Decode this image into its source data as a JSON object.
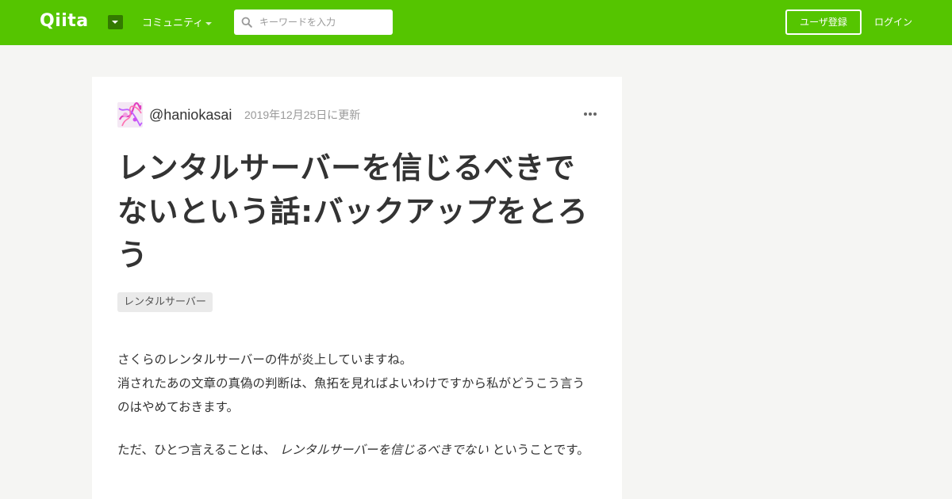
{
  "header": {
    "logo_text": "Qiita",
    "community_label": "コミュニティ",
    "search_placeholder": "キーワードを入力",
    "signup_label": "ユーザ登録",
    "login_label": "ログイン",
    "brand_color": "#55c500"
  },
  "article": {
    "author": "@haniokasai",
    "updated": "2019年12月25日に更新",
    "title": "レンタルサーバーを信じるべきでないという話:バックアップをとろう",
    "tags": [
      "レンタルサーバー"
    ],
    "paragraphs": {
      "p1_line1": "さくらのレンタルサーバーの件が炎上していますね。",
      "p1_line2": "消された",
      "p1_line2b": "あの文章の真偽の判断は、魚拓を見ればよいわけですから私がどうこう言うのはやめておきます。",
      "p2_start": "ただ、ひとつ言えることは、",
      "p2_emph": "レンタルサーバーを信じるべきでない",
      "p2_end": "ということです。"
    }
  },
  "icons": {
    "search": "search-icon",
    "more": "more-horizontal-icon",
    "logo_menu": "caret-down-icon"
  }
}
